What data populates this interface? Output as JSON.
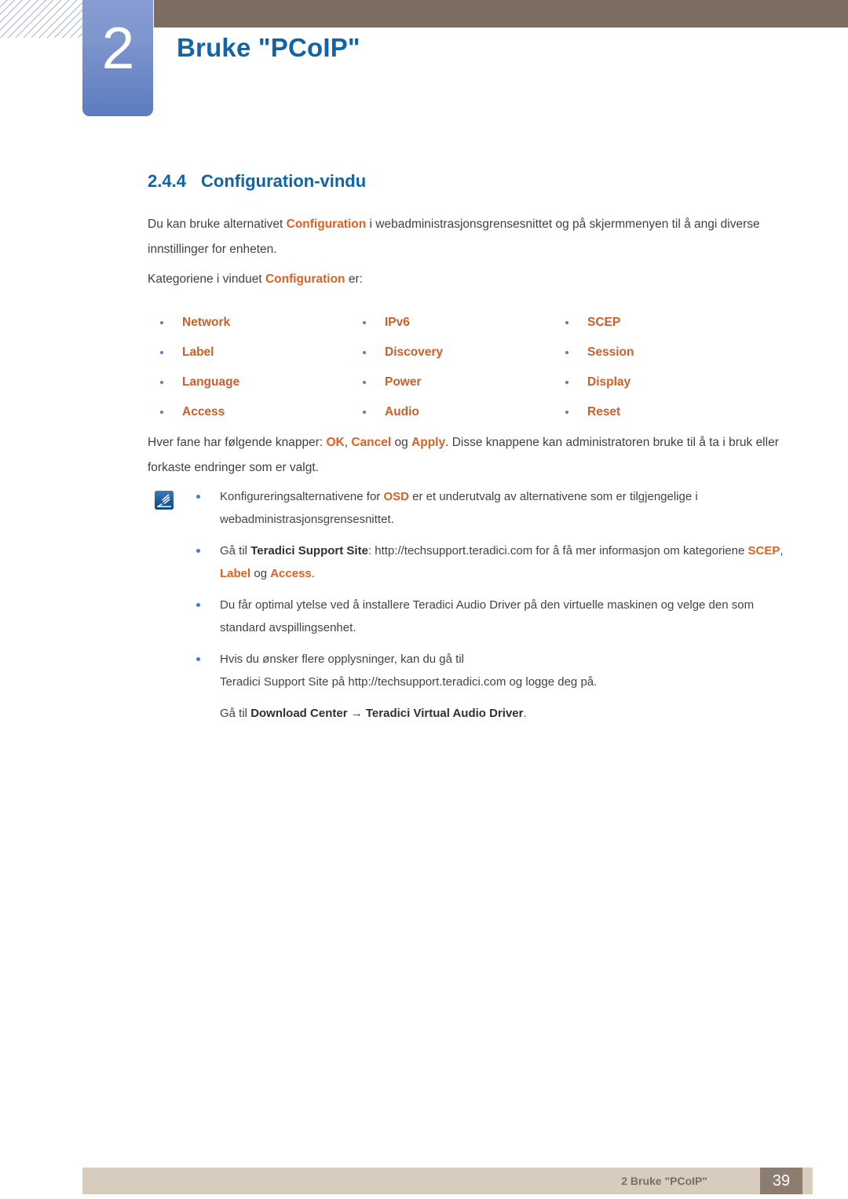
{
  "header": {
    "chapter_number": "2",
    "chapter_title": "Bruke \"PCoIP\"",
    "accent_blue": "#1065a9",
    "bar_brown": "#7b6d60",
    "badge_blue": "#6b87c6"
  },
  "section": {
    "number": "2.4.4",
    "title": "Configuration-vindu"
  },
  "paragraphs": {
    "intro_1": "Du kan bruke alternativet ",
    "intro_term": "Configuration",
    "intro_2": " i webadministrasjonsgrensesnittet og på skjermmenyen til å angi diverse innstillinger for enheten.",
    "kat_1": "Kategoriene i vinduet ",
    "kat_term": "Configuration",
    "kat_2": " er:",
    "btns_1": "Hver fane har følgende knapper: ",
    "btns_ok": "OK",
    "btns_sep1": ", ",
    "btns_cancel": "Cancel",
    "btns_sep2": " og ",
    "btns_apply": "Apply",
    "btns_2": ". Disse knappene kan administratoren bruke til å ta i bruk eller forkaste endringer som er valgt."
  },
  "categories": {
    "rows": [
      {
        "col1": "Network",
        "col2": "IPv6",
        "col3": "SCEP"
      },
      {
        "col1": "Label",
        "col2": "Discovery",
        "col3": "Session"
      },
      {
        "col1": "Language",
        "col2": "Power",
        "col3": "Display"
      },
      {
        "col1": "Access",
        "col2": "Audio",
        "col3": "Reset"
      }
    ],
    "text_color": "#cb5f2a",
    "bullet_color": "#5a7cc0"
  },
  "note": {
    "icon": "note-pen-icon",
    "items": [
      {
        "pre": "Konfigureringsalternativene for ",
        "term": "OSD",
        "post": " er et underutvalg av alternativene som er tilgjengelige i webadministrasjonsgrensesnittet."
      },
      {
        "pre": "Gå til ",
        "bold": "Teradici Support Site",
        "mid": ": http://techsupport.teradici.com for å få mer informasjon om kategoriene ",
        "term1": "SCEP",
        "sep1": ", ",
        "term2": "Label",
        "sep2": " og ",
        "term3": "Access",
        "post": "."
      },
      {
        "pre": "Du får optimal ytelse ved å installere Teradici Audio Driver på den virtuelle maskinen og velge den som standard avspillingsenhet.",
        "term": "",
        "post": ""
      },
      {
        "line1": "Hvis du ønsker flere opplysninger, kan du gå til",
        "line2": "Teradici Support Site på http://techsupport.teradici.com og logge deg på."
      }
    ],
    "closing": {
      "pre": "Gå til ",
      "bold1": "Download Center",
      "arrow": " → ",
      "bold2": "Teradici Virtual Audio Driver",
      "post": "."
    }
  },
  "footer": {
    "text": "2 Bruke \"PCoIP\"",
    "page_number": "39",
    "bar_color": "#d8ccbd",
    "page_box_color": "#8d7c70"
  }
}
